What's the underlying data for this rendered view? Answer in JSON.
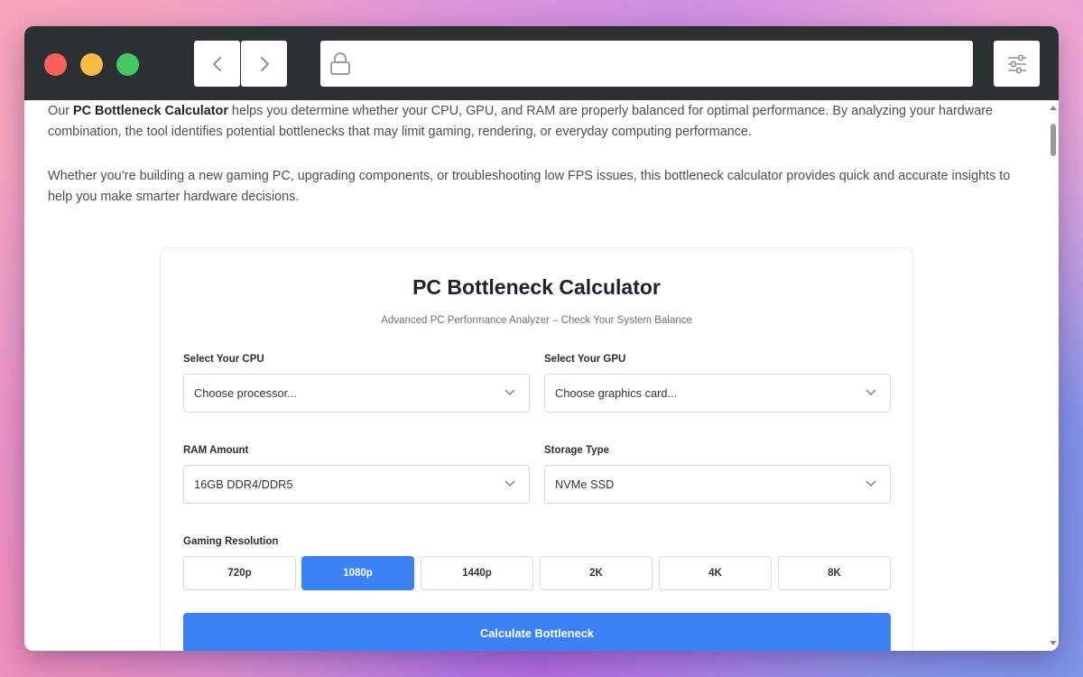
{
  "intro": {
    "p1_prefix": "Our ",
    "p1_bold": "PC Bottleneck Calculator",
    "p1_rest": " helps you determine whether your CPU, GPU, and RAM are properly balanced for optimal performance. By analyzing your hardware combination, the tool identifies potential bottlenecks that may limit gaming, rendering, or everyday computing performance.",
    "p2": "Whether you’re building a new gaming PC, upgrading components, or troubleshooting low FPS issues, this bottleneck calculator provides quick and accurate insights to help you make smarter hardware decisions."
  },
  "calculator": {
    "title": "PC Bottleneck Calculator",
    "subtitle": "Advanced PC Performance Analyzer – Check Your System Balance",
    "cpu": {
      "label": "Select Your CPU",
      "value": "Choose processor..."
    },
    "gpu": {
      "label": "Select Your GPU",
      "value": "Choose graphics card..."
    },
    "ram": {
      "label": "RAM Amount",
      "value": "16GB DDR4/DDR5"
    },
    "storage": {
      "label": "Storage Type",
      "value": "NVMe SSD"
    },
    "resolution": {
      "label": "Gaming Resolution",
      "options": [
        "720p",
        "1080p",
        "1440p",
        "2K",
        "4K",
        "8K"
      ],
      "selected": "1080p"
    },
    "button_label": "Calculate Bottleneck"
  },
  "icons": {
    "back": "chevron-left-icon",
    "forward": "chevron-right-icon",
    "lock": "lock-icon",
    "menu": "sliders-icon",
    "select": "chevron-down-icon"
  },
  "colors": {
    "accent": "#3b82f6",
    "titlebar": "#2b3033",
    "close": "#f7605c",
    "minimize": "#fbbb45",
    "maximize": "#45c761"
  }
}
